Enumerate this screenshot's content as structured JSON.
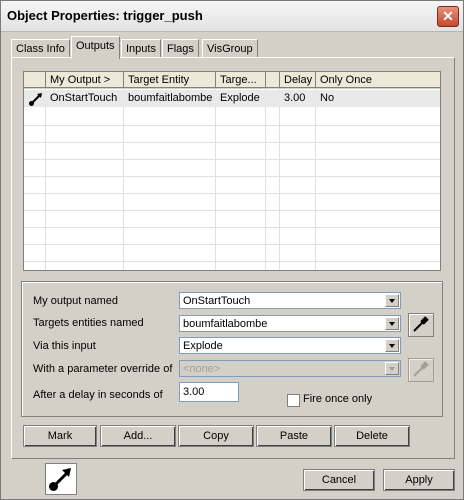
{
  "window": {
    "title": "Object Properties: trigger_push",
    "close_label": "✕"
  },
  "tabs": [
    {
      "label": "Class Info"
    },
    {
      "label": "Outputs"
    },
    {
      "label": "Inputs"
    },
    {
      "label": "Flags"
    },
    {
      "label": "VisGroup"
    }
  ],
  "outputs_list": {
    "columns": [
      "My Output >",
      "Target Entity",
      "Targe...",
      "",
      "Delay",
      "Only Once"
    ],
    "rows": [
      {
        "my_output": "OnStartTouch",
        "target_entity": "boumfaitlabombe",
        "target_input": "Explode",
        "delay": "3.00",
        "only_once": "No"
      }
    ]
  },
  "form": {
    "output_label": "My output named",
    "output_value": "OnStartTouch",
    "target_label": "Targets entities named",
    "target_value": "boumfaitlabombe",
    "input_label": "Via this input",
    "input_value": "Explode",
    "param_label": "With a parameter override of",
    "param_value": "<none>",
    "delay_label": "After a delay in seconds of",
    "delay_value": "3.00",
    "fire_once_label": "Fire once only"
  },
  "buttons": {
    "mark": "Mark",
    "add": "Add...",
    "copy": "Copy",
    "paste": "Paste",
    "delete": "Delete",
    "cancel": "Cancel",
    "apply": "Apply"
  }
}
